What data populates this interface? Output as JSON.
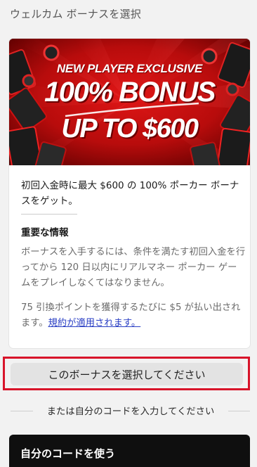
{
  "page": {
    "title": "ウェルカム ボーナスを選択"
  },
  "bonus_card": {
    "banner": {
      "line1": "NEW PLAYER EXCLUSIVE",
      "line2": "100% BONUS",
      "line3": "UP TO $600"
    },
    "description": "初回入金時に最大 $600 の 100% ポーカー ボーナスをゲット。",
    "info_heading": "重要な情報",
    "info_text": "ボーナスを入手するには、条件を満たす初回入金を行ってから 120 日以内にリアルマネー ポーカー ゲームをプレイしなくてはなりません。",
    "points_text": "75 引換ポイントを獲得するたびに $5 が払い出されます。",
    "terms_link": "規約が適用されます。"
  },
  "actions": {
    "select_button": "このボーナスを選択してください",
    "or_text": "または自分のコードを入力してください",
    "own_code_button": "自分のコードを使う"
  },
  "colors": {
    "highlight_border": "#d8142a",
    "link": "#2a3fc4",
    "dark_button": "#0f0f0f"
  }
}
